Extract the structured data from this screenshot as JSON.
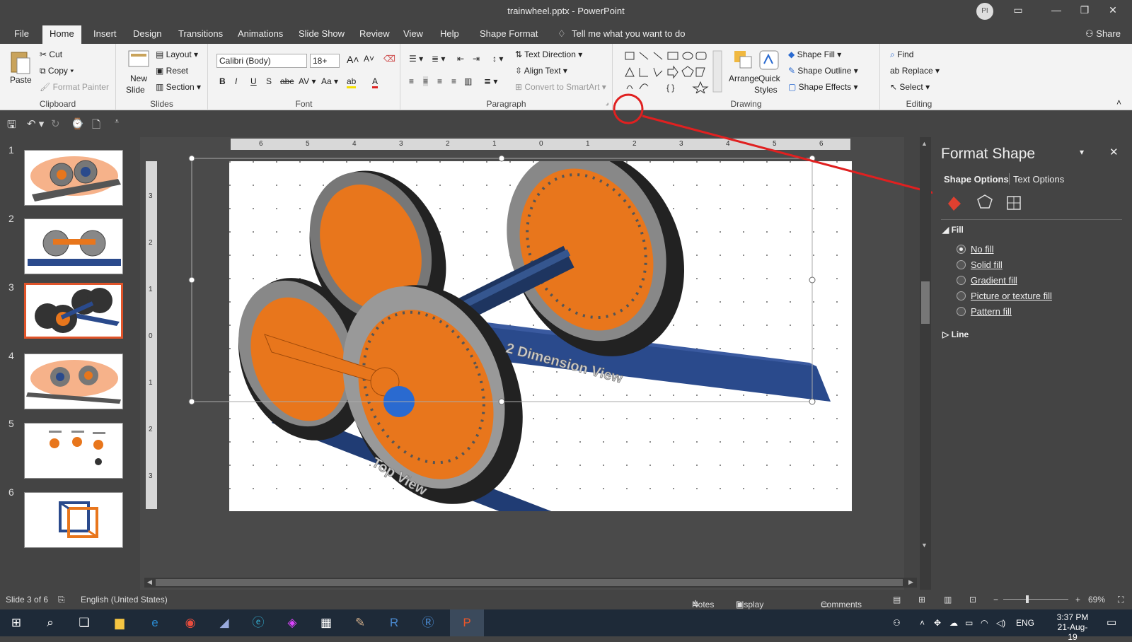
{
  "window": {
    "title": "trainwheel.pptx  -  PowerPoint",
    "avatar_initials": "PI",
    "share_label": "Share"
  },
  "tabs": [
    "File",
    "Home",
    "Insert",
    "Design",
    "Transitions",
    "Animations",
    "Slide Show",
    "Review",
    "View",
    "Help",
    "Shape Format"
  ],
  "active_tab": "Home",
  "tell_me": "Tell me what you want to do",
  "ribbon": {
    "clipboard": {
      "paste": "Paste",
      "cut": "Cut",
      "copy": "Copy",
      "format_painter": "Format Painter",
      "label": "Clipboard"
    },
    "slides": {
      "new_slide": "New",
      "new_slide2": "Slide",
      "layout": "Layout",
      "reset": "Reset",
      "section": "Section",
      "label": "Slides"
    },
    "font": {
      "font_name": "Calibri (Body)",
      "font_size": "18+",
      "label": "Font"
    },
    "paragraph": {
      "text_direction": "Text Direction",
      "align_text": "Align Text",
      "convert_smartart": "Convert to SmartArt",
      "label": "Paragraph"
    },
    "drawing": {
      "arrange": "Arrange",
      "quick_styles": "Quick",
      "quick_styles2": "Styles",
      "shape_fill": "Shape Fill",
      "shape_outline": "Shape Outline",
      "shape_effects": "Shape Effects",
      "label": "Drawing"
    },
    "editing": {
      "find": "Find",
      "replace": "Replace",
      "select": "Select",
      "label": "Editing"
    }
  },
  "ruler_h": [
    "6",
    "5",
    "4",
    "3",
    "2",
    "1",
    "0",
    "1",
    "2",
    "3",
    "4",
    "5",
    "6"
  ],
  "ruler_v": [
    "3",
    "2",
    "1",
    "0",
    "1",
    "2",
    "3"
  ],
  "thumbnails": [
    "1",
    "2",
    "3",
    "4",
    "5",
    "6"
  ],
  "selected_slide": 3,
  "slide_texts": {
    "top_label": "2 Dimension View",
    "bottom_label": "Top View"
  },
  "format_pane": {
    "title": "Format Shape",
    "tab_shape": "Shape Options",
    "tab_text": "Text Options",
    "fill_section": "Fill",
    "fill_options": [
      "No fill",
      "Solid fill",
      "Gradient fill",
      "Picture or texture fill",
      "Pattern fill"
    ],
    "selected_fill": "No fill",
    "line_section": "Line"
  },
  "status": {
    "slide_info": "Slide 3 of 6",
    "language": "English (United States)",
    "notes": "Notes",
    "display_settings": "Display Settings",
    "comments": "Comments",
    "zoom": "69%"
  },
  "taskbar": {
    "lang": "ENG",
    "time": "3:37 PM",
    "date": "21-Aug-19"
  },
  "colors": {
    "accent": "#e0542a",
    "wheel_orange": "#e8761c",
    "rail_blue": "#2a4a8c",
    "annotation_red": "#e02020"
  }
}
